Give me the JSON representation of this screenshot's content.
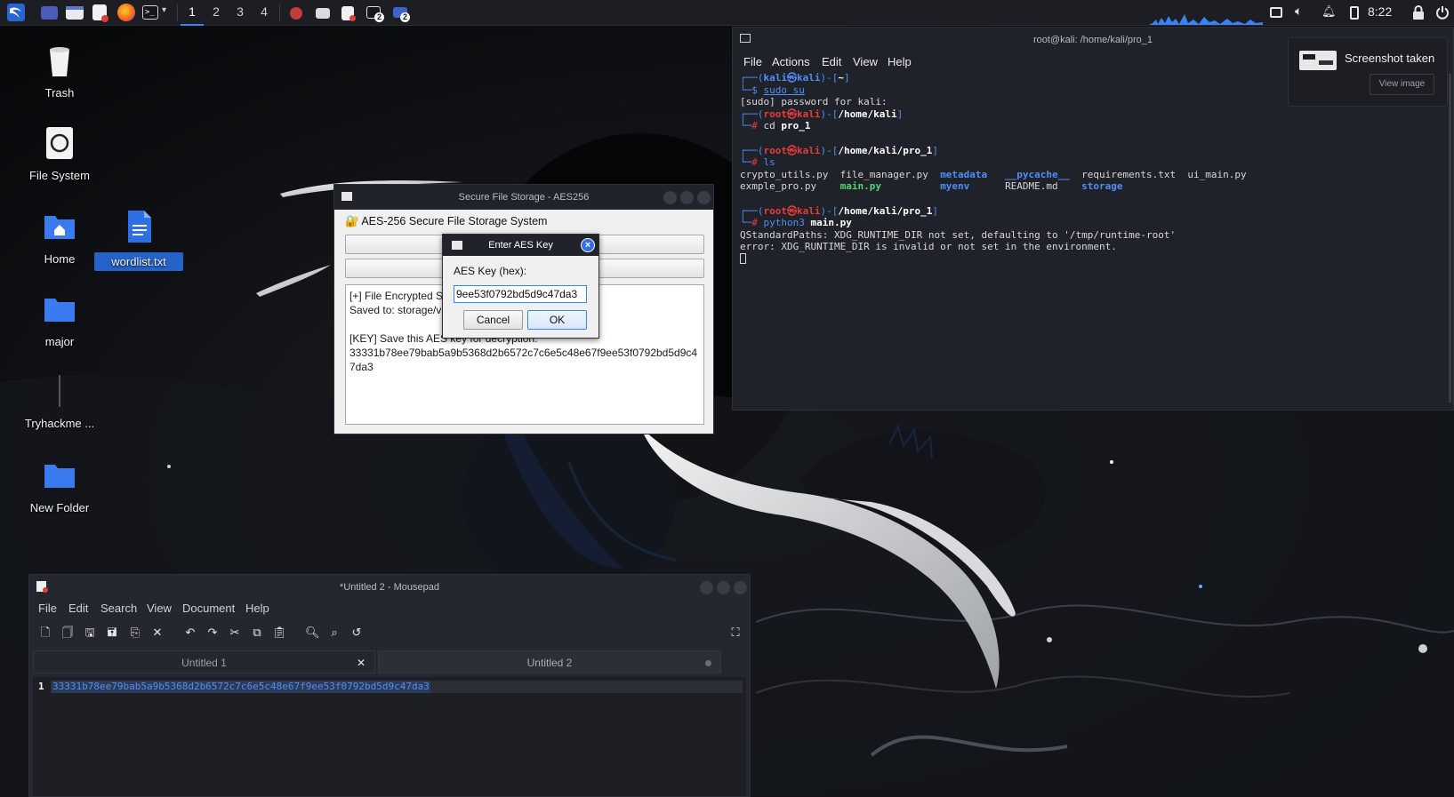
{
  "top_panel": {
    "workspaces": [
      "1",
      "2",
      "3",
      "4"
    ],
    "active_workspace": "1",
    "task_badges": [
      "2",
      "2"
    ],
    "clock": "8:22",
    "icons": [
      "kali-menu-icon",
      "desktop-icon",
      "file-manager-icon",
      "text-editor-icon",
      "firefox-icon",
      "terminal-icon",
      "screenshot-icon",
      "volume-icon",
      "notification-bell-icon",
      "battery-icon",
      "lock-icon",
      "power-icon"
    ]
  },
  "desktop": {
    "icons": [
      {
        "label": "Trash"
      },
      {
        "label": "File System"
      },
      {
        "label": "Home"
      },
      {
        "label": "wordlist.txt"
      },
      {
        "label": "major"
      },
      {
        "label": "Tryhackme ..."
      },
      {
        "label": "New Folder"
      }
    ]
  },
  "terminal": {
    "title": "root@kali: /home/kali/pro_1",
    "menu": [
      "File",
      "Actions",
      "Edit",
      "View",
      "Help"
    ],
    "lines": {
      "p1_user": "kali㉿kali",
      "p1_dir": "~",
      "p1_cmd": "sudo su",
      "sudo_prompt": "[sudo] password for kali:",
      "p2_user": "root㉿kali",
      "p2_dir": "/home/kali",
      "p2_cmd_1": "cd",
      "p2_cmd_2": "pro_1",
      "p3_user": "root㉿kali",
      "p3_dir": "/home/kali/pro_1",
      "p3_cmd": "ls",
      "ls_col1_r1": "crypto_utils.py",
      "ls_col2_r1": "file_manager.py",
      "ls_col3_r1": "metadata",
      "ls_col4_r1": "__pycache__",
      "ls_col5_r1": "requirements.txt",
      "ls_col6_r1": "ui_main.py",
      "ls_col1_r2": "exmple_pro.py",
      "ls_col2_r2": "main.py",
      "ls_col3_r2": "myenv",
      "ls_col4_r2": "README.md",
      "ls_col5_r2": "storage",
      "p4_user": "root㉿kali",
      "p4_dir": "/home/kali/pro_1",
      "p4_cmd_1": "python3",
      "p4_cmd_2": "main.py",
      "out1": "QStandardPaths: XDG_RUNTIME_DIR not set, defaulting to '/tmp/runtime-root'",
      "out2": "error: XDG_RUNTIME_DIR is invalid or not set in the environment."
    }
  },
  "notification": {
    "title": "Screenshot taken",
    "button": "View image"
  },
  "aes_window": {
    "title": "Secure File Storage - AES256",
    "heading": "🔐 AES-256 Secure File Storage System",
    "log_line1": "[+] File Encrypted S",
    "log_line2": "Saved to: storage/v",
    "log_line3": "[KEY] Save this AES key for decryption:",
    "log_key": "33331b78ee79bab5a9b5368d2b6572c7c6e5c48e67f9ee53f0792bd5d9c47da3"
  },
  "key_dialog": {
    "title": "Enter AES Key",
    "label": "AES Key (hex):",
    "value": "9ee53f0792bd5d9c47da3",
    "cancel": "Cancel",
    "ok": "OK"
  },
  "mousepad": {
    "title": "*Untitled 2 - Mousepad",
    "menu": [
      "File",
      "Edit",
      "Search",
      "View",
      "Document",
      "Help"
    ],
    "tabs": [
      {
        "label": "Untitled 1"
      },
      {
        "label": "Untitled 2"
      }
    ],
    "line_number": "1",
    "content": "33331b78ee79bab5a9b5368d2b6572c7c6e5c48e67f9ee53f0792bd5d9c47da3"
  }
}
